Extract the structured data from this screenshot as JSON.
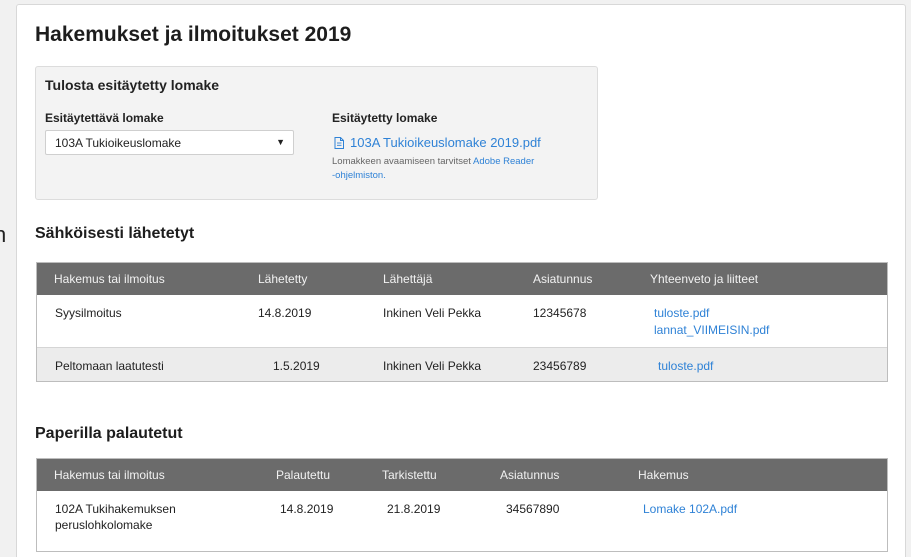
{
  "page": {
    "title": "Hakemukset ja ilmoitukset 2019",
    "edge_glyph": "n"
  },
  "print_form": {
    "title": "Tulosta esitäytetty lomake",
    "select_label": "Esitäytettävä lomake",
    "select_value": "103A Tukioikeuslomake",
    "prefilled_label": "Esitäytetty lomake",
    "pdf_link": "103A Tukioikeuslomake 2019.pdf",
    "note_prefix": "Lomakkeen avaamiseen tarvitset",
    "note_link": "Adobe Reader",
    "note_suffix": "-ohjelmiston."
  },
  "electronic": {
    "title": "Sähköisesti lähetetyt",
    "headers": [
      "Hakemus tai ilmoitus",
      "Lähetetty",
      "Lähettäjä",
      "Asiatunnus",
      "Yhteenveto ja liitteet"
    ],
    "rows": [
      {
        "name": "Syysilmoitus",
        "date": "14.8.2019",
        "sender": "Inkinen Veli Pekka",
        "case_id": "12345678",
        "links": [
          "tuloste.pdf",
          "lannat_VIIMEISIN.pdf"
        ]
      },
      {
        "name": "Peltomaan laatutesti",
        "date": "1.5.2019",
        "sender": "Inkinen Veli Pekka",
        "case_id": "23456789",
        "links": [
          "tuloste.pdf"
        ]
      }
    ]
  },
  "paper": {
    "title": "Paperilla palautetut",
    "headers": [
      "Hakemus tai ilmoitus",
      "Palautettu",
      "Tarkistettu",
      "Asiatunnus",
      "Hakemus"
    ],
    "rows": [
      {
        "name_line1": "102A Tukihakemuksen",
        "name_line2": "peruslohkolomake",
        "returned": "14.8.2019",
        "checked": "21.8.2019",
        "case_id": "34567890",
        "link": "Lomake 102A.pdf"
      }
    ]
  },
  "colors": {
    "header_bg": "#6b6b6b",
    "link": "#2f82d6",
    "alt_row": "#ececec",
    "box_bg": "#f3f3f3"
  },
  "icons": {
    "pdf": "document-icon",
    "dropdown": "caret-down-icon"
  }
}
